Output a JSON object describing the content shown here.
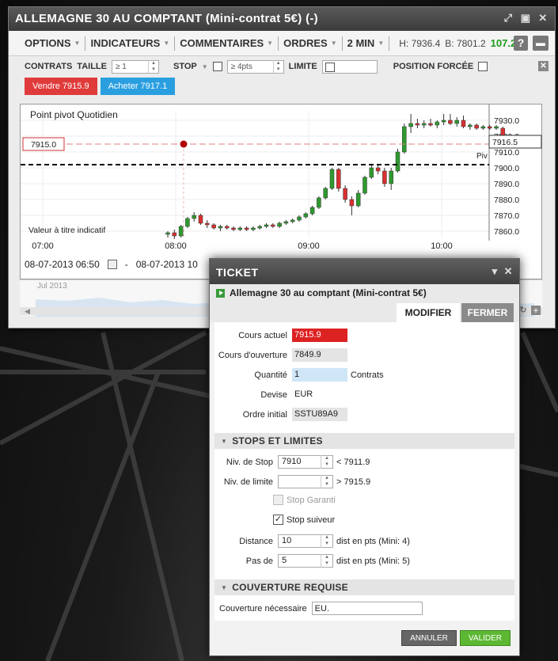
{
  "window": {
    "title": "ALLEMAGNE 30 AU COMPTANT (Mini-contrat 5€) (-)",
    "menu": {
      "options": "OPTIONS",
      "indicators": "INDICATEURS",
      "comments": "COMMENTAIRES",
      "orders": "ORDRES",
      "interval": "2 MIN",
      "high": "H: 7936.4",
      "low": "B: 7801.2",
      "change": "107.2",
      "help": "?"
    },
    "orderbar": {
      "contracts": "CONTRATS",
      "size": "TAILLE",
      "size_placeholder": "≥ 1",
      "stop": "STOP",
      "stop_placeholder": "≥ 4pts",
      "limit": "LIMITE",
      "forced": "POSITION FORCÉE"
    },
    "sell_button": "Vendre 7915.9",
    "buy_button": "Acheter 7917.1",
    "from_date": "08-07-2013 06:50",
    "date_separator": "-",
    "to_date": "08-07-2013 10",
    "navigator_label": "Jul 2013"
  },
  "chart_data": {
    "type": "candlestick",
    "legend": "Point pivot  Quotidien",
    "note": "Valeur à titre indicatif",
    "marker_label": "7915.0",
    "current_price_label": "7916.5",
    "pivot_label": "Piv",
    "x_ticks": [
      "07:00",
      "08:00",
      "09:00",
      "10:00"
    ],
    "y_ticks": [
      "7930.0",
      "7920.0",
      "7910.0",
      "7900.0",
      "7890.0",
      "7880.0",
      "7870.0",
      "7860.0"
    ],
    "ylim": [
      7856,
      7936
    ],
    "pivot_level": 7902,
    "marker_level": 7915,
    "candles": [
      {
        "o": 7858,
        "h": 7860,
        "l": 7856,
        "c": 7859
      },
      {
        "o": 7859,
        "h": 7861,
        "l": 7855,
        "c": 7857
      },
      {
        "o": 7857,
        "h": 7864,
        "l": 7856,
        "c": 7863
      },
      {
        "o": 7863,
        "h": 7869,
        "l": 7862,
        "c": 7868
      },
      {
        "o": 7868,
        "h": 7872,
        "l": 7866,
        "c": 7870
      },
      {
        "o": 7870,
        "h": 7871,
        "l": 7864,
        "c": 7865
      },
      {
        "o": 7865,
        "h": 7867,
        "l": 7862,
        "c": 7864
      },
      {
        "o": 7864,
        "h": 7865,
        "l": 7861,
        "c": 7862
      },
      {
        "o": 7862,
        "h": 7864,
        "l": 7860,
        "c": 7863
      },
      {
        "o": 7863,
        "h": 7864,
        "l": 7861,
        "c": 7862
      },
      {
        "o": 7862,
        "h": 7863,
        "l": 7860,
        "c": 7861
      },
      {
        "o": 7861,
        "h": 7863,
        "l": 7860,
        "c": 7862
      },
      {
        "o": 7862,
        "h": 7863,
        "l": 7860,
        "c": 7861
      },
      {
        "o": 7861,
        "h": 7863,
        "l": 7860,
        "c": 7862
      },
      {
        "o": 7862,
        "h": 7864,
        "l": 7861,
        "c": 7863
      },
      {
        "o": 7863,
        "h": 7865,
        "l": 7862,
        "c": 7864
      },
      {
        "o": 7864,
        "h": 7865,
        "l": 7862,
        "c": 7863
      },
      {
        "o": 7863,
        "h": 7866,
        "l": 7862,
        "c": 7865
      },
      {
        "o": 7865,
        "h": 7867,
        "l": 7864,
        "c": 7866
      },
      {
        "o": 7866,
        "h": 7868,
        "l": 7865,
        "c": 7867
      },
      {
        "o": 7867,
        "h": 7870,
        "l": 7866,
        "c": 7869
      },
      {
        "o": 7869,
        "h": 7872,
        "l": 7868,
        "c": 7871
      },
      {
        "o": 7871,
        "h": 7876,
        "l": 7870,
        "c": 7875
      },
      {
        "o": 7875,
        "h": 7882,
        "l": 7874,
        "c": 7881
      },
      {
        "o": 7881,
        "h": 7888,
        "l": 7880,
        "c": 7887
      },
      {
        "o": 7887,
        "h": 7900,
        "l": 7886,
        "c": 7899
      },
      {
        "o": 7899,
        "h": 7900,
        "l": 7885,
        "c": 7887
      },
      {
        "o": 7887,
        "h": 7889,
        "l": 7878,
        "c": 7880
      },
      {
        "o": 7880,
        "h": 7882,
        "l": 7870,
        "c": 7876
      },
      {
        "o": 7876,
        "h": 7886,
        "l": 7875,
        "c": 7884
      },
      {
        "o": 7884,
        "h": 7895,
        "l": 7883,
        "c": 7894
      },
      {
        "o": 7894,
        "h": 7902,
        "l": 7893,
        "c": 7900
      },
      {
        "o": 7900,
        "h": 7902,
        "l": 7896,
        "c": 7898
      },
      {
        "o": 7898,
        "h": 7900,
        "l": 7888,
        "c": 7890
      },
      {
        "o": 7890,
        "h": 7900,
        "l": 7886,
        "c": 7898
      },
      {
        "o": 7898,
        "h": 7912,
        "l": 7897,
        "c": 7910
      },
      {
        "o": 7910,
        "h": 7928,
        "l": 7909,
        "c": 7926
      },
      {
        "o": 7926,
        "h": 7934,
        "l": 7922,
        "c": 7928
      },
      {
        "o": 7928,
        "h": 7931,
        "l": 7925,
        "c": 7927
      },
      {
        "o": 7927,
        "h": 7930,
        "l": 7925,
        "c": 7928
      },
      {
        "o": 7928,
        "h": 7931,
        "l": 7926,
        "c": 7927
      },
      {
        "o": 7927,
        "h": 7930,
        "l": 7925,
        "c": 7929
      },
      {
        "o": 7929,
        "h": 7934,
        "l": 7927,
        "c": 7930
      },
      {
        "o": 7930,
        "h": 7934,
        "l": 7927,
        "c": 7928
      },
      {
        "o": 7928,
        "h": 7932,
        "l": 7926,
        "c": 7930
      },
      {
        "o": 7930,
        "h": 7933,
        "l": 7925,
        "c": 7926
      },
      {
        "o": 7926,
        "h": 7928,
        "l": 7924,
        "c": 7927
      },
      {
        "o": 7927,
        "h": 7928,
        "l": 7924,
        "c": 7925
      },
      {
        "o": 7925,
        "h": 7927,
        "l": 7924,
        "c": 7926
      },
      {
        "o": 7926,
        "h": 7927,
        "l": 7924,
        "c": 7925
      },
      {
        "o": 7925,
        "h": 7927,
        "l": 7924,
        "c": 7926
      },
      {
        "o": 7925,
        "h": 7926,
        "l": 7915,
        "c": 7917
      }
    ]
  },
  "ticket": {
    "title": "TICKET",
    "instrument": "Allemagne 30 au comptant (Mini-contrat 5€)",
    "tab_modify": "MODIFIER",
    "tab_close": "FERMER",
    "current_price_label": "Cours actuel",
    "current_price": "7915.9",
    "open_price_label": "Cours d'ouverture",
    "open_price": "7849.9",
    "quantity_label": "Quantité",
    "quantity": "1",
    "quantity_unit": "Contrats",
    "currency_label": "Devise",
    "currency": "EUR",
    "order_label": "Ordre initial",
    "order_id": "SSTU89A9",
    "stops_header": "STOPS ET LIMITES",
    "stop_level_label": "Niv. de Stop",
    "stop_level": "7910",
    "stop_hint": "< 7911.9",
    "limit_level_label": "Niv. de limite",
    "limit_hint": "> 7915.9",
    "guaranteed_stop": "Stop Garanti",
    "trailing_stop": "Stop suiveur",
    "distance_label": "Distance",
    "distance": "10",
    "distance_hint": "dist en pts (Mini: 4)",
    "step_label": "Pas de",
    "step": "5",
    "step_hint": "dist en pts (Mini: 5)",
    "cover_header": "COUVERTURE REQUISE",
    "cover_label": "Couverture nécessaire",
    "cover_value": "EU.",
    "cancel": "ANNULER",
    "validate": "VALIDER"
  },
  "colors": {
    "up": "#2e9a2e",
    "down": "#d93030",
    "sell": "#e03b3b",
    "buy": "#2a9fe0"
  }
}
